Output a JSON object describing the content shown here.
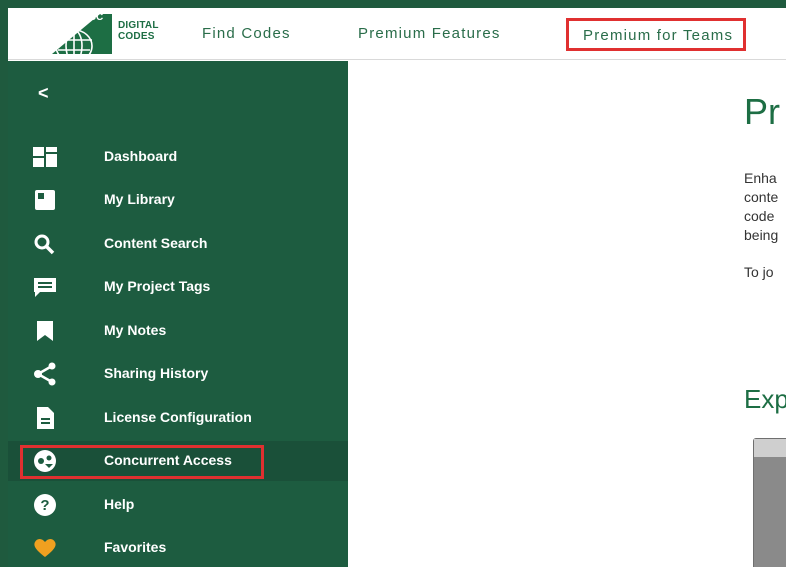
{
  "header": {
    "logo_brand": "ICC",
    "logo_line1": "DIGITAL",
    "logo_line2": "CODES",
    "nav": [
      {
        "label": "Find Codes"
      },
      {
        "label": "Premium Features"
      },
      {
        "label": "Premium for Teams"
      }
    ]
  },
  "sidebar": {
    "collapse_glyph": "<",
    "items": [
      {
        "label": "Dashboard",
        "icon": "dashboard-icon"
      },
      {
        "label": "My Library",
        "icon": "library-icon"
      },
      {
        "label": "Content Search",
        "icon": "search-icon"
      },
      {
        "label": "My Project Tags",
        "icon": "tag-icon"
      },
      {
        "label": "My Notes",
        "icon": "bookmark-icon"
      },
      {
        "label": "Sharing History",
        "icon": "share-icon"
      },
      {
        "label": "License Configuration",
        "icon": "document-icon"
      },
      {
        "label": "Concurrent Access",
        "icon": "concurrent-access-icon"
      },
      {
        "label": "Help",
        "icon": "help-icon"
      },
      {
        "label": "Favorites",
        "icon": "heart-icon"
      }
    ]
  },
  "main": {
    "heading": "Pr",
    "paragraph_lines": [
      "Enha",
      "conte",
      "code",
      "being"
    ],
    "paragraph2": "To jo",
    "subheading": "Exp"
  },
  "colors": {
    "brand_green": "#1d5c40",
    "accent_green": "#1d6e44",
    "highlight_red": "#e03030",
    "favorites_orange": "#f0a020"
  }
}
